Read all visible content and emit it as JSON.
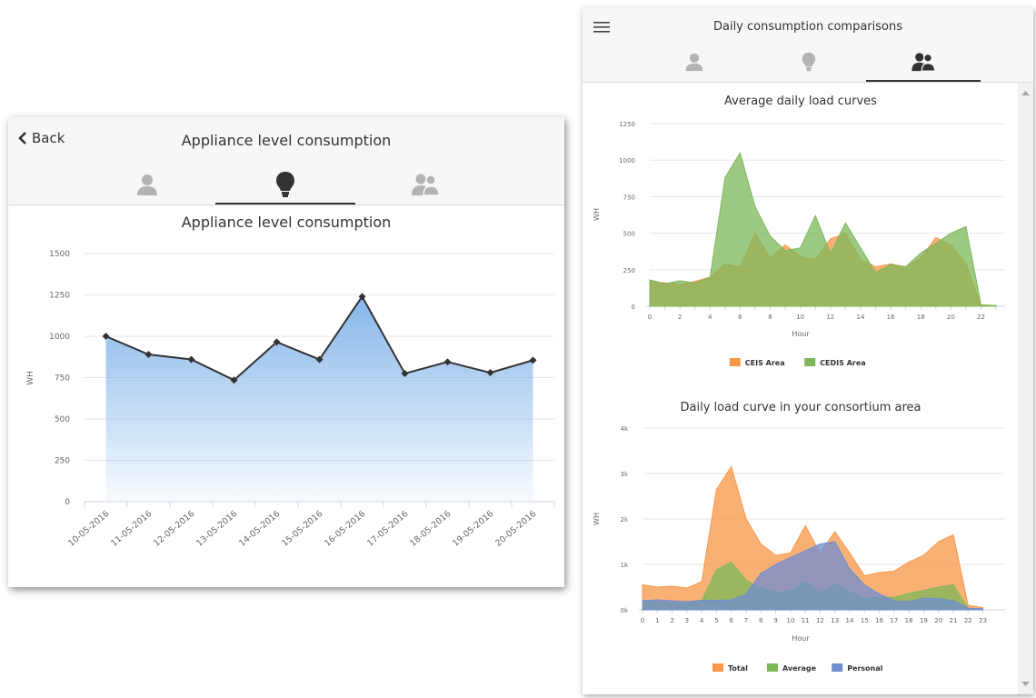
{
  "left": {
    "back_label": "Back",
    "title": "Appliance level consumption",
    "tabs": [
      {
        "name": "personal",
        "icon": "person-icon",
        "active": false
      },
      {
        "name": "appliance",
        "icon": "lightbulb-icon",
        "active": true
      },
      {
        "name": "comparison",
        "icon": "group-icon",
        "active": false
      }
    ],
    "chart_data": {
      "type": "area",
      "title": "Appliance level consumption",
      "ylabel": "WH",
      "xlabel": "",
      "ylim": [
        0,
        1500
      ],
      "yticks": [
        "0",
        "250",
        "500",
        "750",
        "1000",
        "1250",
        "1500"
      ],
      "categories": [
        "10-05-2016",
        "11-05-2016",
        "12-05-2016",
        "13-05-2016",
        "14-05-2016",
        "15-05-2016",
        "16-05-2016",
        "17-05-2016",
        "18-05-2016",
        "19-05-2016",
        "20-05-2016"
      ],
      "values": [
        1000,
        890,
        860,
        735,
        965,
        860,
        1240,
        775,
        845,
        780,
        855
      ],
      "color": "#7fb2e8",
      "line_color": "#333333"
    }
  },
  "right": {
    "title": "Daily consumption comparisons",
    "tabs": [
      {
        "name": "personal",
        "icon": "person-icon",
        "active": false
      },
      {
        "name": "appliance",
        "icon": "lightbulb-icon",
        "active": false
      },
      {
        "name": "comparison",
        "icon": "group-icon",
        "active": true
      }
    ],
    "chart_data": [
      {
        "type": "area",
        "title": "Average daily load curves",
        "xlabel": "Hour",
        "ylabel": "WH",
        "ylim": [
          0,
          1250
        ],
        "yticks": [
          "0",
          "250",
          "500",
          "750",
          "1000",
          "1250"
        ],
        "xticks": [
          "0",
          "2",
          "4",
          "6",
          "8",
          "10",
          "12",
          "14",
          "16",
          "18",
          "20",
          "22"
        ],
        "x": [
          0,
          1,
          2,
          3,
          4,
          5,
          6,
          7,
          8,
          9,
          10,
          11,
          12,
          13,
          14,
          15,
          16,
          17,
          18,
          19,
          20,
          21,
          22,
          23
        ],
        "series": [
          {
            "name": "CEIS Area",
            "color": "#f79646",
            "values": [
              170,
              160,
              150,
              170,
              200,
              290,
              270,
              500,
              330,
              420,
              340,
              320,
              460,
              500,
              320,
              270,
              290,
              270,
              330,
              470,
              420,
              290,
              10,
              5
            ]
          },
          {
            "name": "CEDIS Area",
            "color": "#7cb85a",
            "values": [
              180,
              155,
              175,
              160,
              195,
              880,
              1050,
              680,
              480,
              380,
              400,
              620,
              360,
              570,
              400,
              230,
              285,
              270,
              365,
              430,
              500,
              545,
              10,
              5
            ]
          }
        ],
        "legend": "bottom"
      },
      {
        "type": "area",
        "title": "Daily load curve in your consortium area",
        "xlabel": "Hour",
        "ylabel": "WH",
        "ylim": [
          0,
          4000
        ],
        "yticks": [
          "0k",
          "1k",
          "2k",
          "3k",
          "4k"
        ],
        "xticks": [
          "0",
          "1",
          "2",
          "3",
          "4",
          "5",
          "6",
          "7",
          "8",
          "9",
          "10",
          "11",
          "12",
          "13",
          "14",
          "15",
          "16",
          "17",
          "18",
          "19",
          "20",
          "21",
          "22",
          "23"
        ],
        "x": [
          0,
          1,
          2,
          3,
          4,
          5,
          6,
          7,
          8,
          9,
          10,
          11,
          12,
          13,
          14,
          15,
          16,
          17,
          18,
          19,
          20,
          21,
          22,
          23
        ],
        "series": [
          {
            "name": "Total",
            "color": "#f79646",
            "values": [
              550,
              500,
              520,
              480,
              620,
              2650,
              3150,
              2000,
              1450,
              1200,
              1250,
              1850,
              1250,
              1720,
              1250,
              750,
              820,
              850,
              1050,
              1200,
              1500,
              1650,
              100,
              50
            ]
          },
          {
            "name": "Average",
            "color": "#7cb85a",
            "values": [
              180,
              170,
              150,
              140,
              200,
              880,
              1050,
              650,
              480,
              380,
              400,
              620,
              360,
              580,
              400,
              230,
              280,
              270,
              360,
              430,
              500,
              550,
              30,
              20
            ]
          },
          {
            "name": "Personal",
            "color": "#6f8ed1",
            "values": [
              200,
              220,
              200,
              180,
              210,
              210,
              220,
              350,
              800,
              1000,
              1150,
              1300,
              1450,
              1500,
              900,
              550,
              350,
              200,
              180,
              260,
              250,
              200,
              40,
              20
            ]
          }
        ],
        "legend": "bottom"
      }
    ]
  }
}
